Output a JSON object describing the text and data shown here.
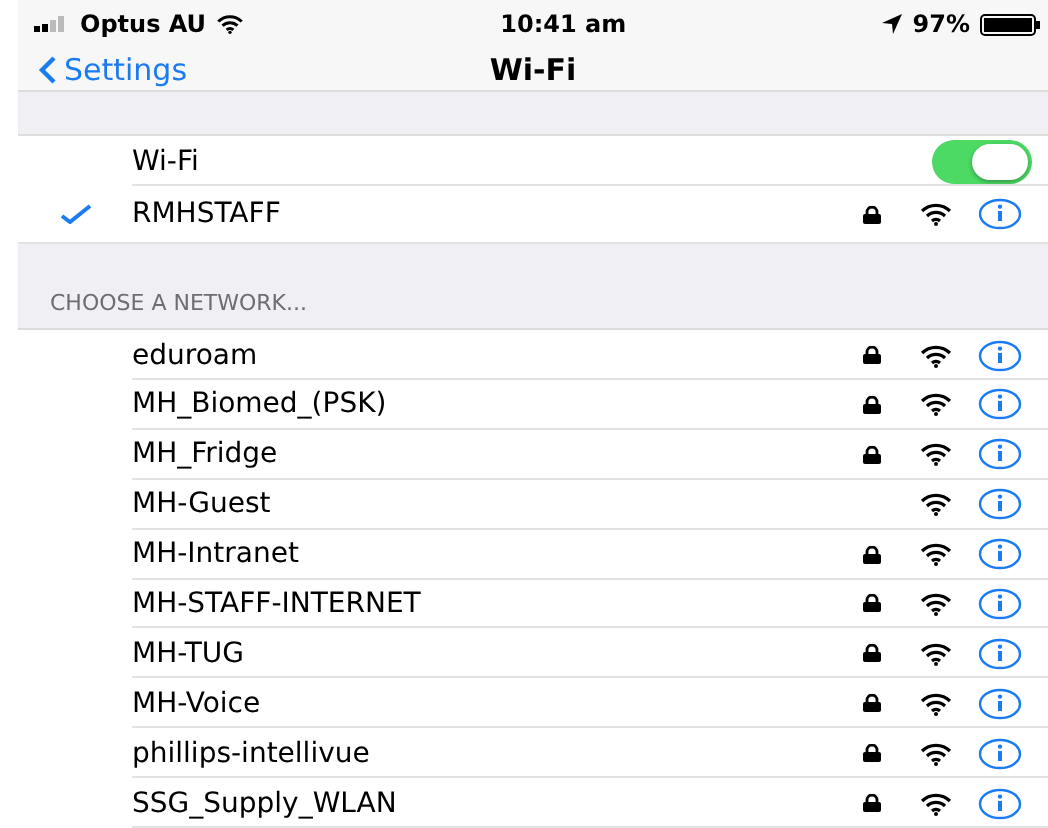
{
  "status_bar": {
    "carrier": "Optus AU",
    "time": "10:41 am",
    "battery": "97%"
  },
  "nav": {
    "back": "Settings",
    "title": "Wi-Fi"
  },
  "wifi_toggle": {
    "label": "Wi-Fi",
    "on": true
  },
  "connected": {
    "name": "RMHSTAFF",
    "selected": true,
    "locked": true
  },
  "section_header": "CHOOSE A NETWORK...",
  "networks": [
    {
      "name": "eduroam",
      "locked": true
    },
    {
      "name": "MH_Biomed_(PSK)",
      "locked": true
    },
    {
      "name": "MH_Fridge",
      "locked": true
    },
    {
      "name": "MH-Guest",
      "locked": false
    },
    {
      "name": "MH-Intranet",
      "locked": true
    },
    {
      "name": "MH-STAFF-INTERNET",
      "locked": true
    },
    {
      "name": "MH-TUG",
      "locked": true
    },
    {
      "name": "MH-Voice",
      "locked": true
    },
    {
      "name": "phillips-intellivue",
      "locked": true
    },
    {
      "name": "SSG_Supply_WLAN",
      "locked": true
    }
  ]
}
